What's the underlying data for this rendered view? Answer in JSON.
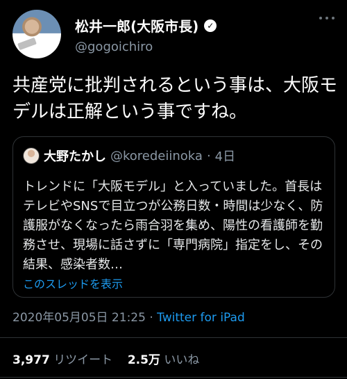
{
  "author": {
    "display_name": "松井一郎(大阪市長)",
    "handle": "@gogoichiro",
    "verified_icon": "verified-badge-icon"
  },
  "tweet": {
    "text": "共産党に批判されるという事は、大阪モデルは正解という事ですね。"
  },
  "quoted_tweet": {
    "display_name": "大野たかし",
    "handle": "@koredeiinoka",
    "separator": "·",
    "age": "4日",
    "text": "トレンドに「大阪モデル」と入っていました。首長はテレビやSNSで目立つが公務日数・時間は少なく、防護服がなくなったら雨合羽を集め、陽性の看護師を勤務させ、現場に話さずに「専門病院」指定をし、その結果、感染者数…",
    "thread_link": "このスレッドを表示"
  },
  "meta": {
    "timestamp": "2020年05月05日 21:25",
    "separator": "·",
    "app": "Twitter for iPad"
  },
  "stats": {
    "retweets_count": "3,977",
    "retweets_label": "リツイート",
    "likes_count": "2.5万",
    "likes_label": "いいね"
  },
  "colors": {
    "background": "#000000",
    "link": "#1d9bf0",
    "muted": "#8b98a5"
  }
}
